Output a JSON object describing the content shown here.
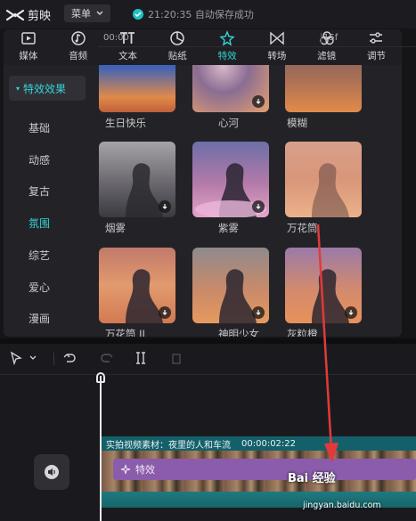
{
  "app": {
    "name": "剪映",
    "menu_label": "菜单",
    "save_status": "21:20:35 自动保存成功"
  },
  "tabs": [
    {
      "label": "媒体",
      "icon": "media-icon"
    },
    {
      "label": "音频",
      "icon": "audio-icon"
    },
    {
      "label": "文本",
      "icon": "text-icon"
    },
    {
      "label": "贴纸",
      "icon": "sticker-icon"
    },
    {
      "label": "特效",
      "icon": "effects-icon",
      "active": true
    },
    {
      "label": "转场",
      "icon": "transition-icon"
    },
    {
      "label": "滤镜",
      "icon": "filter-icon"
    },
    {
      "label": "调节",
      "icon": "adjust-icon"
    }
  ],
  "categories": {
    "header": "特效效果",
    "items": [
      "基础",
      "动感",
      "复古",
      "氛围",
      "综艺",
      "爱心",
      "漫画"
    ],
    "highlighted": "氛围"
  },
  "effects": [
    {
      "label": "生日快乐"
    },
    {
      "label": "心河"
    },
    {
      "label": "模糊"
    },
    {
      "label": "烟雾"
    },
    {
      "label": "紫雾"
    },
    {
      "label": "万花筒"
    },
    {
      "label": "万花筒 II"
    },
    {
      "label": "神明少女"
    },
    {
      "label": "灰粒橙"
    }
  ],
  "timeline": {
    "ruler_start": "00:00",
    "ruler_mark": "15f",
    "clip_title": "实拍视频素材：夜里的人和车流",
    "clip_duration": "00:00:02:22",
    "effect_clip_label": "特效"
  },
  "watermark": {
    "brand": "Bai 经验",
    "url": "jingyan.baidu.com"
  },
  "colors": {
    "accent": "#35d4d6",
    "effect_clip": "#8b5cab",
    "video_track": "#14606a"
  }
}
